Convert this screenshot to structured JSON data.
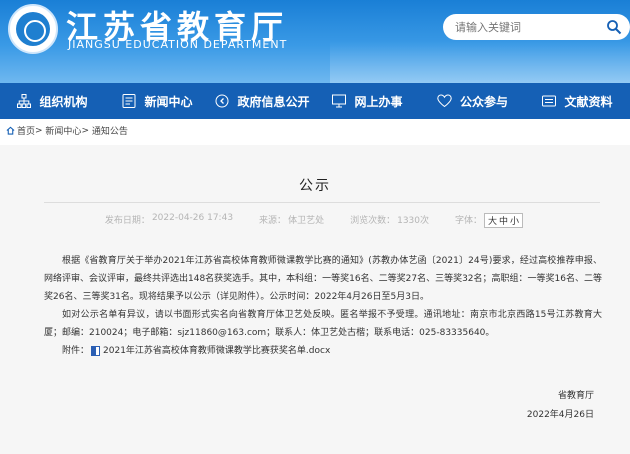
{
  "header": {
    "title": "江苏省教育厅",
    "subtitle": "JIANGSU EDUCATION DEPARTMENT",
    "search_placeholder": "请输入关键词",
    "logo_icon": "jiangsu-education-logo"
  },
  "nav": {
    "items": [
      {
        "label": "组织机构",
        "icon": "org-chart-icon"
      },
      {
        "label": "新闻中心",
        "icon": "news-icon"
      },
      {
        "label": "政府信息公开",
        "icon": "info-disclosure-icon"
      },
      {
        "label": "网上办事",
        "icon": "monitor-icon"
      },
      {
        "label": "公众参与",
        "icon": "heart-icon"
      },
      {
        "label": "文献资料",
        "icon": "documents-icon"
      }
    ]
  },
  "breadcrumb": {
    "home": "首页",
    "news": "新闻中心",
    "current": "通知公告"
  },
  "article": {
    "title": "公示",
    "publish_label": "发布日期：",
    "publish_date": "2022-04-26 17:43",
    "source_label": "来源：",
    "source": "体卫艺处",
    "views_label": "浏览次数：",
    "views": "1330次",
    "font_label": "字体：",
    "font_sizes": [
      "大",
      "中",
      "小"
    ],
    "paragraphs": [
      "根据《省教育厅关于举办2021年江苏省高校体育教师微课教学比赛的通知》(苏教办体艺函〔2021〕24号)要求，经过高校推荐申报、网络评审、会议评审，最终共评选出148名获奖选手。其中，本科组：一等奖16名、二等奖27名、三等奖32名；高职组：一等奖16名、二等奖26名、三等奖31名。现将结果予以公示（详见附件）。公示时间：2022年4月26日至5月3日。",
      "如对公示名单有异议，请以书面形式实名向省教育厅体卫艺处反映。匿名举报不予受理。通讯地址：南京市北京西路15号江苏教育大厦；邮编：210024；电子邮箱：sjz11860@163.com；联系人：体卫艺处古楷；联系电话：025-83335640。"
    ],
    "attachment_label": "附件：",
    "attachment_name": "2021年江苏省高校体育教师微课教学比赛获奖名单.docx",
    "signature": "省教育厅",
    "signature_date": "2022年4月26日"
  },
  "colors": {
    "header_blue": "#1a7fd6",
    "nav_blue": "#1560b5",
    "content_bg": "#f6f6f6"
  }
}
